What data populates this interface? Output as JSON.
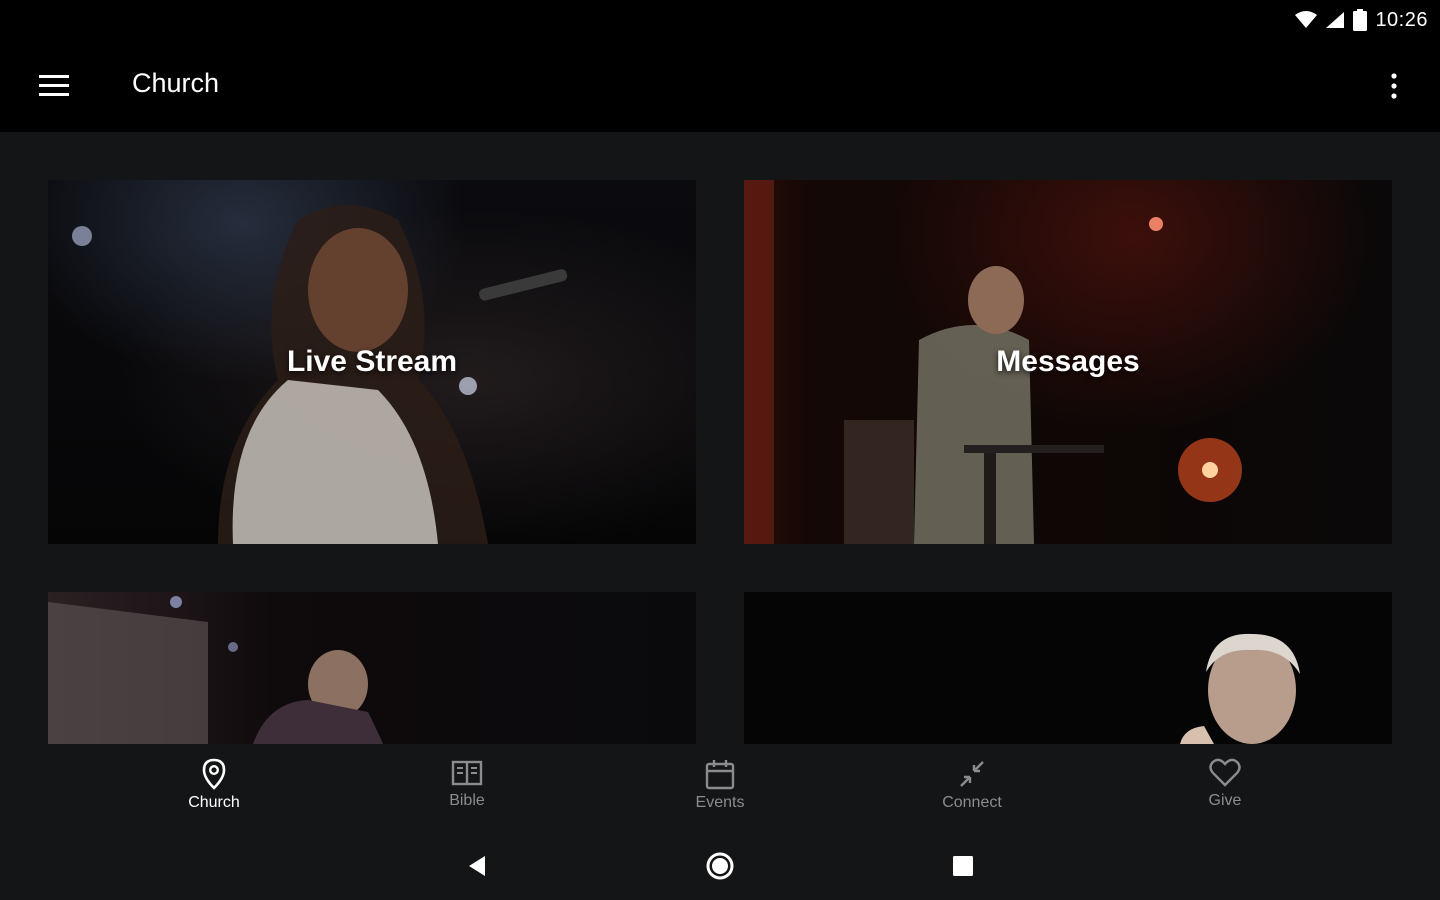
{
  "status_bar": {
    "time": "10:26",
    "icons": [
      "wifi-icon",
      "cell-signal-icon",
      "battery-icon"
    ]
  },
  "app_bar": {
    "title": "Church",
    "menu_icon": "hamburger-menu-icon",
    "overflow_icon": "more-vert-icon"
  },
  "cards": [
    {
      "label": "Live Stream"
    },
    {
      "label": "Messages"
    },
    {
      "label": ""
    },
    {
      "label": ""
    }
  ],
  "bottom_nav": {
    "items": [
      {
        "label": "Church",
        "icon": "location-pin-icon",
        "active": true
      },
      {
        "label": "Bible",
        "icon": "book-icon",
        "active": false
      },
      {
        "label": "Events",
        "icon": "calendar-icon",
        "active": false
      },
      {
        "label": "Connect",
        "icon": "connect-arrows-icon",
        "active": false
      },
      {
        "label": "Give",
        "icon": "heart-icon",
        "active": false
      }
    ]
  },
  "system_nav": {
    "icons": [
      "back-icon",
      "home-icon",
      "recents-icon"
    ]
  },
  "colors": {
    "app_bar_bg": "#000000",
    "content_bg": "#141516",
    "nav_active": "#ffffff",
    "nav_inactive": "#8a8c8e"
  }
}
